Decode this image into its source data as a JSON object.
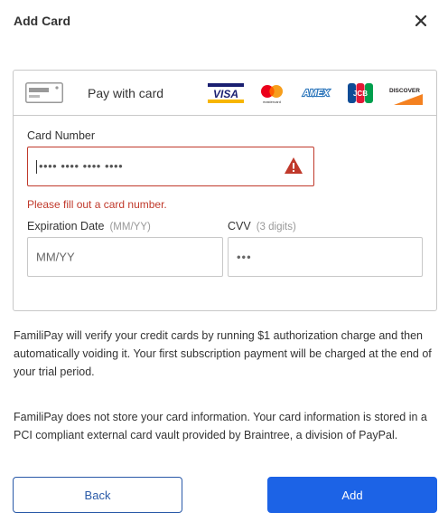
{
  "dialog": {
    "title": "Add Card"
  },
  "card_form": {
    "pay_label": "Pay with card",
    "brands": [
      "visa",
      "mastercard",
      "amex",
      "jcb",
      "discover"
    ],
    "brand_text": {
      "visa": "VISA",
      "mastercard": "mastercard",
      "amex": "AMEX",
      "jcb": "JCB",
      "discover": "DISCOVER"
    },
    "card_number": {
      "label": "Card Number",
      "value": "•••• •••• •••• ••••",
      "error": "Please fill out a card number."
    },
    "expiration": {
      "label": "Expiration Date",
      "hint": "(MM/YY)",
      "placeholder": "MM/YY"
    },
    "cvv": {
      "label": "CVV",
      "hint": "(3 digits)",
      "placeholder": "•••"
    }
  },
  "info": {
    "paragraph1": "FamiliPay will verify your credit cards by running $1 authorization charge and then automatically voiding it. Your first subscription payment will be charged at the end of your trial period.",
    "paragraph2": "FamiliPay does not store your card information. Your card information is stored in a PCI compliant external card vault provided by Braintree, a division of PayPal."
  },
  "buttons": {
    "back": "Back",
    "add": "Add"
  },
  "colors": {
    "error": "#c0392b",
    "primary": "#1c63e6",
    "back_border": "#2a5aa8"
  }
}
